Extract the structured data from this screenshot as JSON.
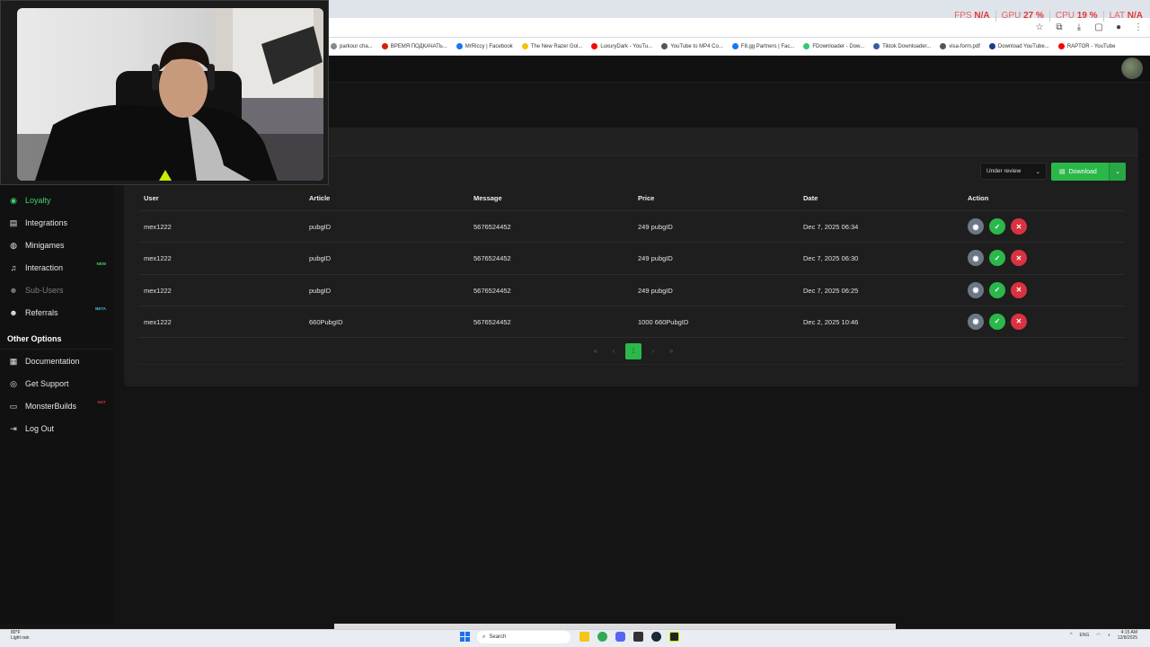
{
  "browser": {
    "bookmarks": [
      {
        "label": "parkour cha...",
        "color": "#888888"
      },
      {
        "label": "ВРЕМЯ ПОДКАЧАТЬ...",
        "color": "#d81e06"
      },
      {
        "label": "MrRiccy | Facebook",
        "color": "#1877f2"
      },
      {
        "label": "The New Razer Gol...",
        "color": "#f1c40f"
      },
      {
        "label": "LuxuryDark - YouTu...",
        "color": "#ff0000"
      },
      {
        "label": "YouTube to MP4 Co...",
        "color": "#555555"
      },
      {
        "label": "F8.gg Partners | Fac...",
        "color": "#1877f2"
      },
      {
        "label": "FDownloader - Dow...",
        "color": "#2ecc71"
      },
      {
        "label": "Tiktok Downloader...",
        "color": "#3a5ba0"
      },
      {
        "label": "visa-form.pdf",
        "color": "#555555"
      },
      {
        "label": "Download YouTube...",
        "color": "#1a3c8e"
      },
      {
        "label": "RAPTOR - YouTube",
        "color": "#ff0000"
      }
    ],
    "stats": {
      "fps_label": "FPS",
      "fps_value": "N/A",
      "gpu_label": "GPU",
      "gpu_value": "27 %",
      "cpu_label": "CPU",
      "cpu_value": "19 %",
      "lat_label": "LAT",
      "lat_value": "N/A"
    }
  },
  "sidebar": {
    "items": [
      {
        "label": "Loyalty",
        "icon": "circle-icon",
        "state": "active"
      },
      {
        "label": "Integrations",
        "icon": "card-icon",
        "state": "normal"
      },
      {
        "label": "Minigames",
        "icon": "gamepad-icon",
        "state": "normal"
      },
      {
        "label": "Interaction",
        "icon": "music-icon",
        "state": "normal",
        "badge": "NEW",
        "badge_color": "#3dd26b"
      },
      {
        "label": "Sub-Users",
        "icon": "users-icon",
        "state": "disabled"
      },
      {
        "label": "Referrals",
        "icon": "people-icon",
        "state": "normal",
        "badge": "BETA",
        "badge_color": "#3cc3d9"
      }
    ],
    "section_title": "Other Options",
    "other_items": [
      {
        "label": "Documentation",
        "icon": "book-icon"
      },
      {
        "label": "Get Support",
        "icon": "support-icon"
      },
      {
        "label": "MonsterBuilds",
        "icon": "laptop-icon",
        "badge": "HOT",
        "badge_color": "#d93240"
      },
      {
        "label": "Log Out",
        "icon": "logout-icon"
      }
    ]
  },
  "filter": {
    "status_label": "Under review"
  },
  "download": {
    "label": "Download"
  },
  "table": {
    "headers": [
      "User",
      "Article",
      "Message",
      "Price",
      "Date",
      "Action"
    ],
    "rows": [
      {
        "user": "mex1222",
        "article": "pubgID",
        "message": "5676524452",
        "price": "249 pubgID",
        "date": "Dec 7, 2025 06:34"
      },
      {
        "user": "mex1222",
        "article": "pubgID",
        "message": "5676524452",
        "price": "249 pubgID",
        "date": "Dec 7, 2025 06:30"
      },
      {
        "user": "mex1222",
        "article": "pubgID",
        "message": "5676524452",
        "price": "249 pubgID",
        "date": "Dec 7, 2025 06:25"
      },
      {
        "user": "mex1222",
        "article": "660PubgID",
        "message": "5676524452",
        "price": "1000 660PubgID",
        "date": "Dec 2, 2025 10:46"
      }
    ]
  },
  "pagination": {
    "first": "«",
    "prev": "‹",
    "current": "1",
    "next": "›",
    "last": "»"
  },
  "taskbar": {
    "weather_temp": "80°F",
    "weather_text": "Light rain",
    "search_placeholder": "Search",
    "language": "ENG",
    "time": "4:15 AM",
    "date": "12/8/2025"
  },
  "colors": {
    "accent": "#2bb84a",
    "danger": "#d93240",
    "view": "#6c7785",
    "background": "#141414"
  }
}
